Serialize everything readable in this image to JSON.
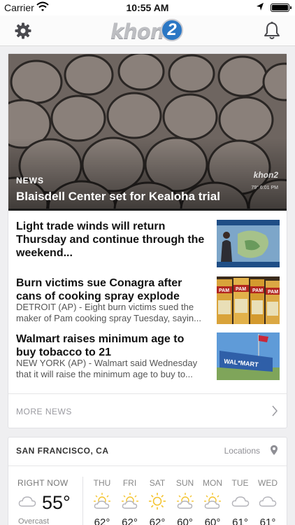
{
  "status_bar": {
    "carrier": "Carrier",
    "time": "10:55 AM"
  },
  "nav": {
    "logo_text": "khon",
    "logo_number": "2"
  },
  "hero": {
    "section": "NEWS",
    "headline": "Blaisdell Center set for Kealoha trial",
    "watermark": "khon2",
    "watermark_small": "79°   6:01 PM"
  },
  "stories": [
    {
      "title": "Light trade winds will return Thursday and continue through the weekend...",
      "summary": ""
    },
    {
      "title": "Burn victims sue Conagra after cans of cooking spray explode",
      "summary_1": "DETROIT (AP) - Eight burn victims sued the",
      "summary_2": "maker of Pam cooking spray Tuesday, sayin..."
    },
    {
      "title": "Walmart raises minimum age to buy tobacco to 21",
      "summary_1": "NEW YORK (AP) - Walmart said Wednesday",
      "summary_2": "that it will raise the minimum age to buy to..."
    }
  ],
  "thumb_text": {
    "pam": "PAM",
    "walmart": "WAL*MART"
  },
  "more_news": "MORE NEWS",
  "weather": {
    "city": "SAN FRANCISCO, CA",
    "locations_label": "Locations",
    "now_label": "RIGHT NOW",
    "now_temp": "55°",
    "now_condition": "Overcast",
    "days": [
      {
        "name": "THU",
        "temp": "62°",
        "icon": "partly-sunny-icon"
      },
      {
        "name": "FRI",
        "temp": "62°",
        "icon": "partly-sunny-icon"
      },
      {
        "name": "SAT",
        "temp": "62°",
        "icon": "sunny-icon"
      },
      {
        "name": "SUN",
        "temp": "60°",
        "icon": "partly-sunny-icon"
      },
      {
        "name": "MON",
        "temp": "60°",
        "icon": "partly-sunny-icon"
      },
      {
        "name": "TUE",
        "temp": "61°",
        "icon": "cloudy-icon"
      },
      {
        "name": "WED",
        "temp": "61°",
        "icon": "cloudy-icon"
      }
    ]
  },
  "colors": {
    "accent_blue": "#2b77c4",
    "sun_yellow": "#f4c430",
    "muted_gray": "#9a9aa0"
  }
}
